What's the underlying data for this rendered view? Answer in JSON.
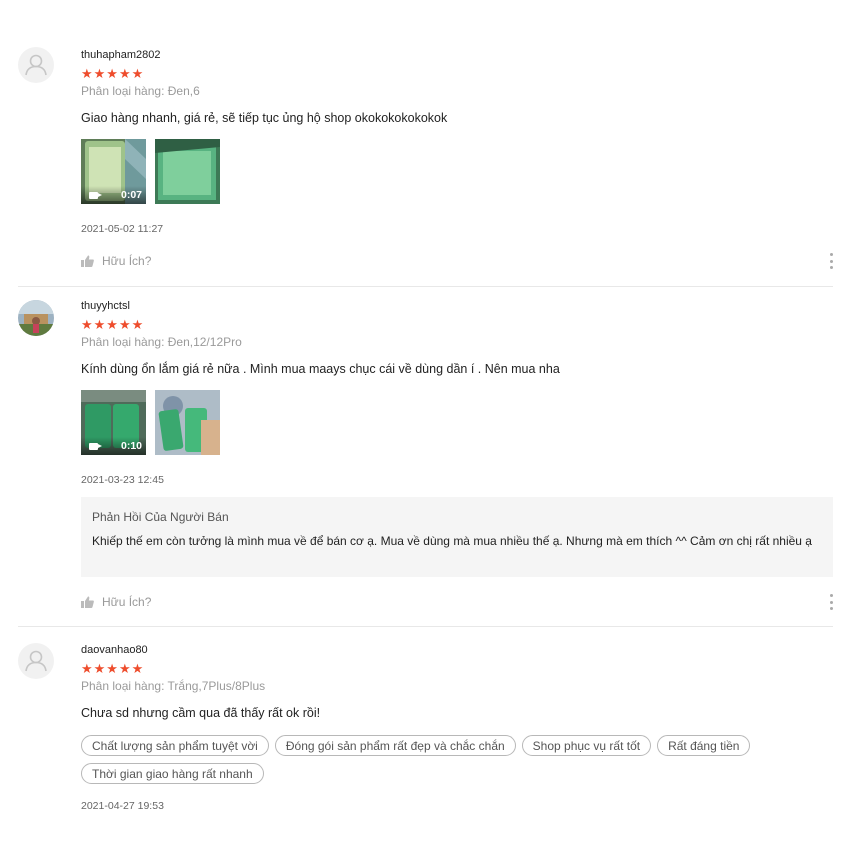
{
  "helpful_label": "Hữu Ích?",
  "reviews": [
    {
      "username": "thuhapham2802",
      "stars": "★★★★★",
      "variant": "Phân loại hàng: Đen,6",
      "comment": "Giao hàng nhanh, giá rẻ, sẽ tiếp tục ủng hộ shop okokokokokokok",
      "video_duration": "0:07",
      "time": "2021-05-02 11:27",
      "avatar_icon": "default-user-icon"
    },
    {
      "username": "thuyyhctsl",
      "stars": "★★★★★",
      "variant": "Phân loại hàng: Đen,12/12Pro",
      "comment": "Kính dùng ổn lắm giá rẻ nữa . Mình mua maays chục cái về dùng dần í . Nên mua nha",
      "video_duration": "0:10",
      "time": "2021-03-23 12:45",
      "seller_reply": {
        "title": "Phản Hồi Của Người Bán",
        "text": "Khiếp thế em còn tưởng là mình mua về để bán cơ ạ. Mua về dùng mà mua nhiều thế ạ. Nhưng mà em thích ^^ Cảm ơn chị rất nhiều ạ"
      }
    },
    {
      "username": "daovanhao80",
      "stars": "★★★★★",
      "variant": "Phân loại hàng: Trắng,7Plus/8Plus",
      "comment": "Chưa sd nhưng cầm qua đã thấy rất ok rồi!",
      "tags": [
        "Chất lượng sản phẩm tuyệt vời",
        "Đóng gói sản phẩm rất đẹp và chắc chắn",
        "Shop phục vụ rất tốt",
        "Rất đáng tiền",
        "Thời gian giao hàng rất nhanh"
      ],
      "time": "2021-04-27 19:53",
      "avatar_icon": "default-user-icon"
    }
  ],
  "colors": {
    "star": "#ee4d2d",
    "muted": "#9a9a9a",
    "reply_bg": "#f5f5f5",
    "divider": "#e8e8e8"
  }
}
